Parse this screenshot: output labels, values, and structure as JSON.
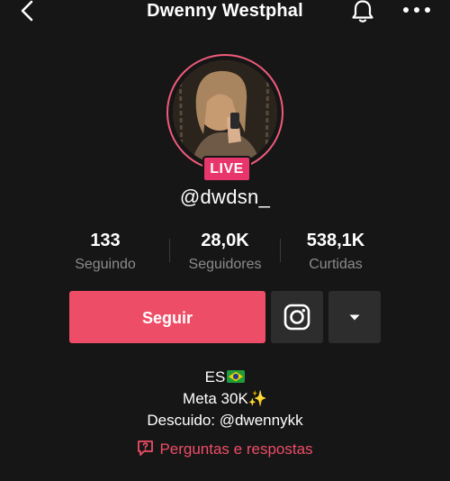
{
  "header": {
    "title": "Dwenny Westphal",
    "back_icon": "chevron-left-icon",
    "bell_icon": "bell-icon",
    "more_icon": "more-dots-icon"
  },
  "profile": {
    "live_badge": "LIVE",
    "username": "@dwdsn_"
  },
  "stats": [
    {
      "value": "133",
      "label": "Seguindo"
    },
    {
      "value": "28,0K",
      "label": "Seguidores"
    },
    {
      "value": "538,1K",
      "label": "Curtidas"
    }
  ],
  "actions": {
    "follow_label": "Seguir",
    "instagram_icon": "instagram-icon",
    "dropdown_icon": "caret-down-icon"
  },
  "bio": {
    "line1": "ES",
    "line1_emoji": "brazil-flag-icon",
    "line2": "Meta 30K✨",
    "line3": "Descuido: @dwennykk"
  },
  "qa": {
    "label": "Perguntas e respostas",
    "icon": "question-bubble-icon"
  },
  "colors": {
    "accent": "#ee4d67",
    "live": "#e8356b",
    "background": "#161616",
    "secondary_button": "#2d2d2d",
    "muted_text": "#8b8b8b"
  }
}
